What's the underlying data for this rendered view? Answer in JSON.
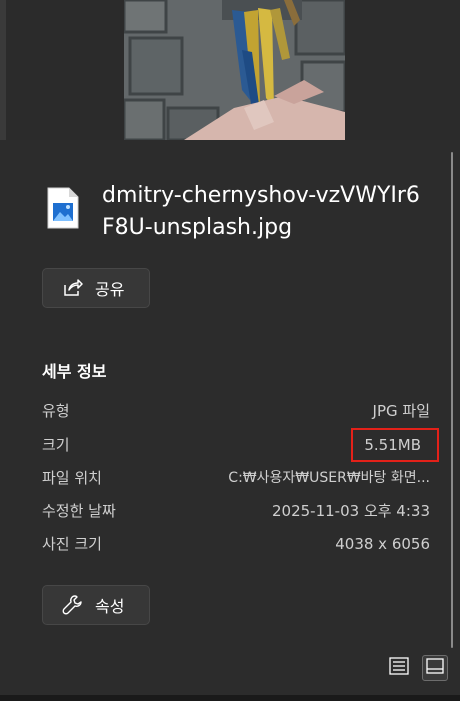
{
  "file": {
    "name": "dmitry-chernyshov-vzVWYIr6F8U-unsplash.jpg"
  },
  "share_button": {
    "label": "공유"
  },
  "details": {
    "title": "세부 정보",
    "rows": [
      {
        "key": "유형",
        "value": "JPG 파일"
      },
      {
        "key": "크기",
        "value": "5.51MB"
      },
      {
        "key": "파일 위치",
        "value": "C:₩사용자₩USER₩바탕 화면..."
      },
      {
        "key": "수정한 날짜",
        "value": "2025-11-03 오후 4:33"
      },
      {
        "key": "사진 크기",
        "value": "4038 x 6056"
      }
    ]
  },
  "properties_button": {
    "label": "속성"
  },
  "colors": {
    "panel_bg": "#2c2c2c",
    "highlight": "#e32119"
  },
  "view_toggle": {
    "icons": [
      "details-view-icon",
      "preview-pane-icon"
    ]
  }
}
